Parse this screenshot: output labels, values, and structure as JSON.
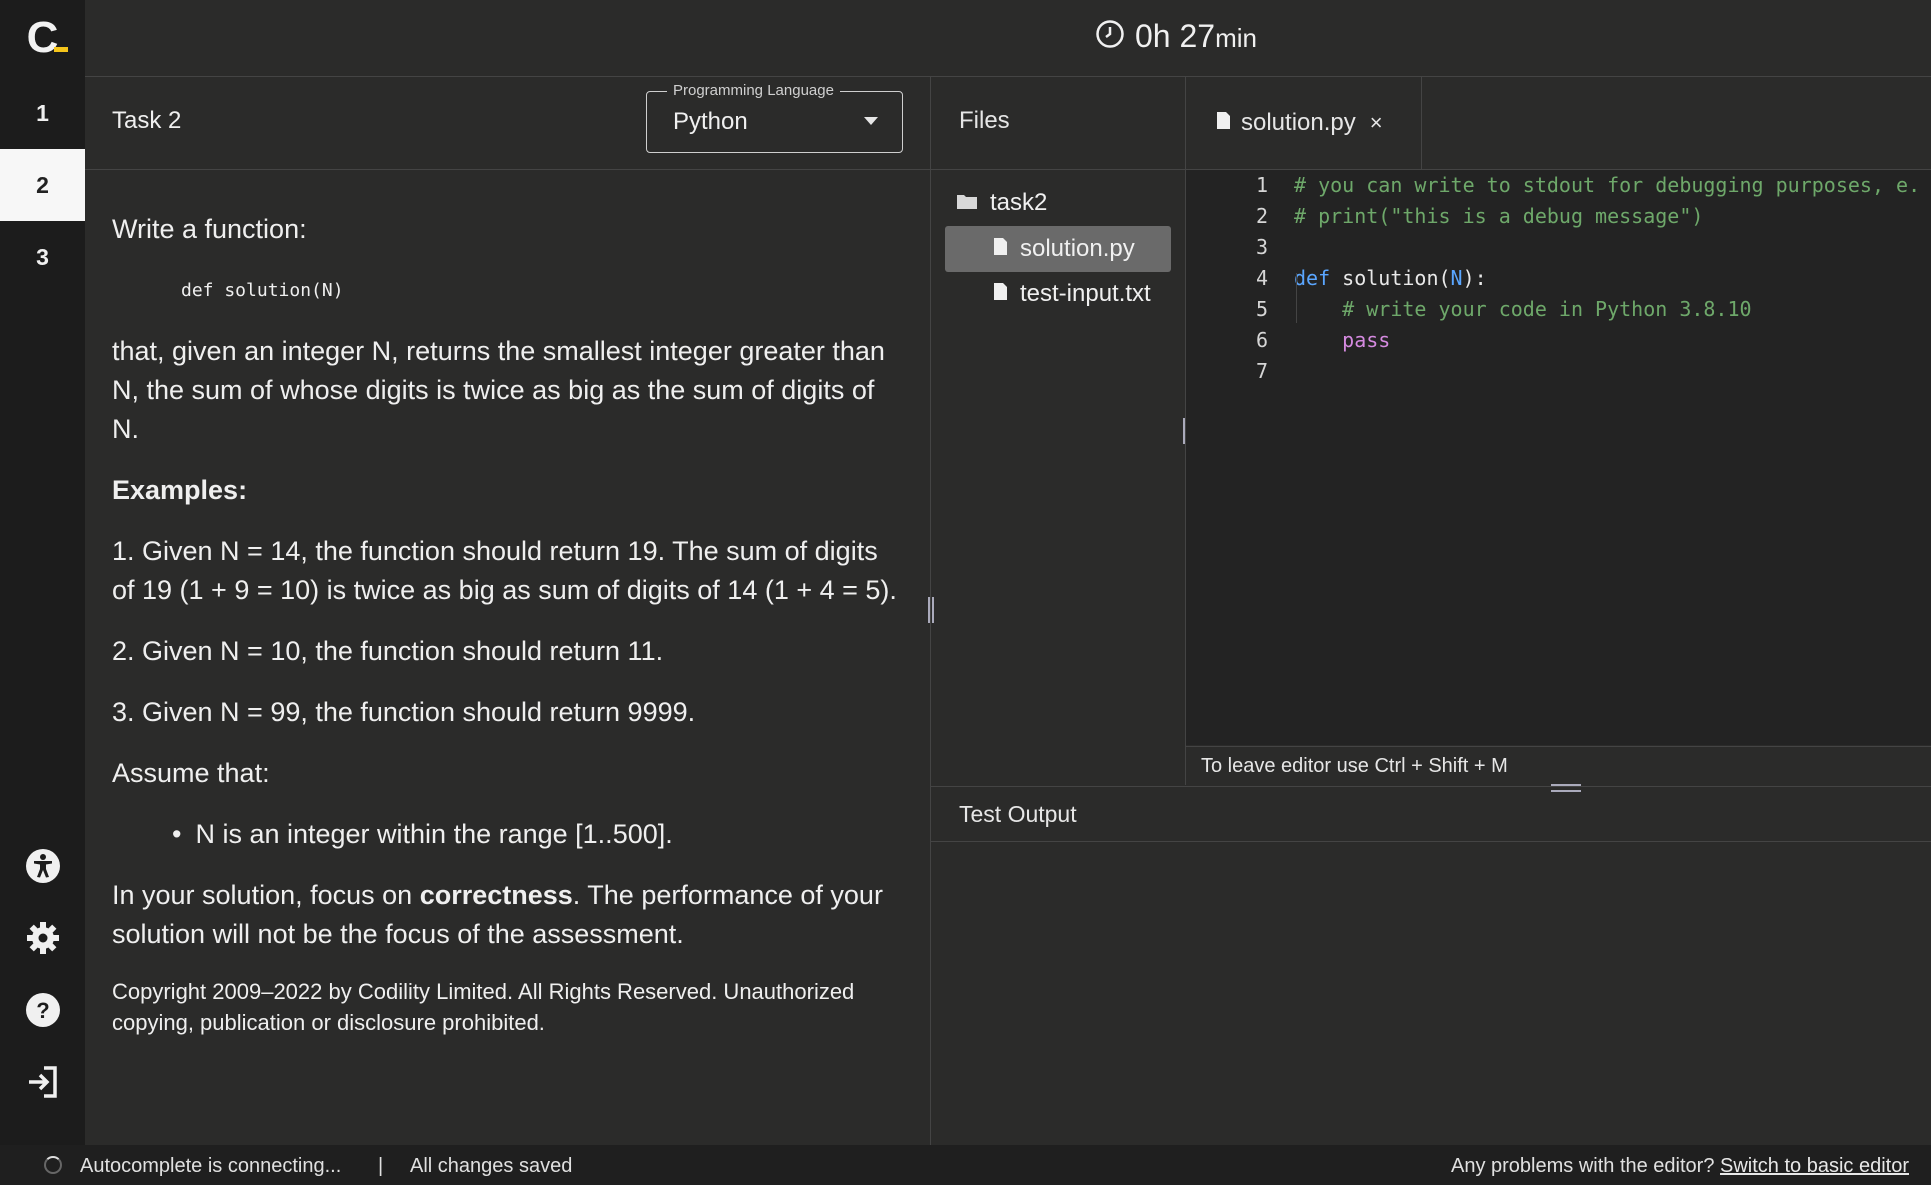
{
  "logo": {
    "letter": "C"
  },
  "timer": {
    "hours": "0h",
    "minutes": "27",
    "unit": "min"
  },
  "tasks": [
    {
      "label": "1"
    },
    {
      "label": "2"
    },
    {
      "label": "3"
    }
  ],
  "task": {
    "title": "Task 2",
    "language_label": "Programming Language",
    "language_value": "Python",
    "intro": "Write a function:",
    "signature": "def solution(N)",
    "description": "that, given an integer N, returns the smallest integer greater than N, the sum of whose digits is twice as big as the sum of digits of N.",
    "examples_heading": "Examples:",
    "examples": [
      "1. Given N = 14, the function should return 19. The sum of digits of 19 (1 + 9 = 10) is twice as big as sum of digits of 14 (1 + 4 = 5).",
      "2. Given N = 10, the function should return 11.",
      "3. Given N = 99, the function should return 9999."
    ],
    "assume_heading": "Assume that:",
    "assumptions": [
      "N is an integer within the range [1..500]."
    ],
    "focus_prefix": "In your solution, focus on ",
    "focus_bold": "correctness",
    "focus_suffix": ". The performance of your solution will not be the focus of the assessment.",
    "copyright": "Copyright 2009–2022 by Codility Limited. All Rights Reserved. Unauthorized copying, publication or disclosure prohibited."
  },
  "files": {
    "title": "Files",
    "folder": "task2",
    "items": [
      "solution.py",
      "test-input.txt"
    ]
  },
  "editor": {
    "tab_label": "solution.py",
    "close_glyph": "×",
    "line_numbers": [
      "1",
      "2",
      "3",
      "4",
      "5",
      "6",
      "7"
    ],
    "lines": {
      "l1": "# you can write to stdout for debugging purposes, e.",
      "l2": "# print(\"this is a debug message\")",
      "l4_kw": "def",
      "l4_name": " solution(",
      "l4_param": "N",
      "l4_end": "):",
      "l5": "    # write your code in Python 3.8.10",
      "l6": "    pass"
    },
    "hint": "To leave editor use Ctrl + Shift + M"
  },
  "test_output": {
    "title": "Test Output"
  },
  "status": {
    "autocomplete": "Autocomplete is connecting...",
    "separator": "|",
    "saved": "All changes saved",
    "problem_text": "Any problems with the editor? ",
    "switch_link": "Switch to basic editor"
  },
  "colors": {
    "accent": "#f5c51b",
    "comment": "#6ea86a",
    "keyword": "#5aa6ff",
    "pass": "#d58ae0"
  }
}
